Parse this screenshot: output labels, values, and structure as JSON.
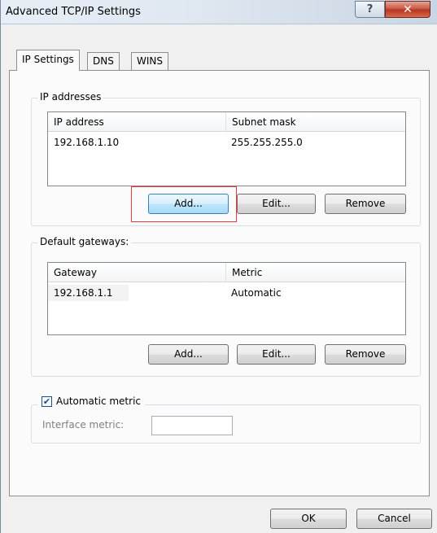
{
  "window": {
    "title": "Advanced TCP/IP Settings",
    "help_glyph": "?",
    "close_glyph": "✕"
  },
  "tabs": [
    {
      "label": "IP Settings",
      "active": true
    },
    {
      "label": "DNS",
      "active": false
    },
    {
      "label": "WINS",
      "active": false
    }
  ],
  "ip_addresses": {
    "group_title": "IP addresses",
    "columns": [
      "IP address",
      "Subnet mask"
    ],
    "rows": [
      [
        "192.168.1.10",
        "255.255.255.0"
      ]
    ],
    "buttons": {
      "add": "Add...",
      "edit": "Edit...",
      "remove": "Remove"
    }
  },
  "default_gateways": {
    "group_title": "Default gateways:",
    "columns": [
      "Gateway",
      "Metric"
    ],
    "rows": [
      [
        "192.168.1.1",
        "Automatic"
      ]
    ],
    "buttons": {
      "add": "Add...",
      "edit": "Edit...",
      "remove": "Remove"
    }
  },
  "metric": {
    "checkbox_label": "Automatic metric",
    "checked": true,
    "check_glyph": "✔",
    "interface_label": "Interface metric:",
    "interface_value": ""
  },
  "footer": {
    "ok": "OK",
    "cancel": "Cancel"
  },
  "colors": {
    "highlight": "#e53a3a",
    "focus_border": "#3c7fb1"
  }
}
